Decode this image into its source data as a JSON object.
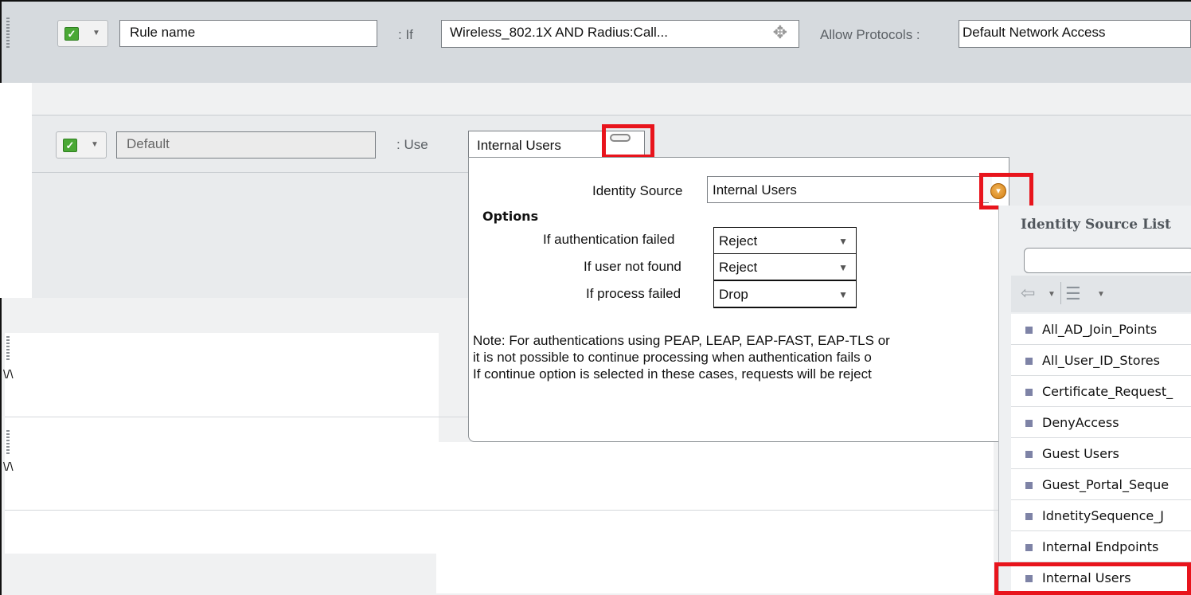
{
  "rule": {
    "name_value": "Rule name",
    "if_label": ": If",
    "condition": "Wireless_802.1X AND Radius:Call...",
    "allow_protocols_label": "Allow Protocols :",
    "allow_protocols_value": "Default Network Access"
  },
  "default_rule": {
    "name_value": "Default",
    "use_label": ":  Use",
    "identity_store": "Internal Users"
  },
  "popover": {
    "identity_source_label": "Identity Source",
    "identity_source_value": "Internal Users",
    "options_heading": "Options",
    "auth_failed_label": "If authentication failed",
    "auth_failed_value": "Reject",
    "user_not_found_label": "If user not found",
    "user_not_found_value": "Reject",
    "process_failed_label": "If process failed",
    "process_failed_value": "Drop",
    "note_line1": "Note: For authentications using PEAP, LEAP, EAP-FAST, EAP-TLS or",
    "note_line2": "it is not possible to continue processing when authentication fails o",
    "note_line3": "If continue option is selected in these cases, requests will be reject"
  },
  "identity_list": {
    "title": "Identity Source List",
    "search_placeholder": "",
    "items": [
      "All_AD_Join_Points",
      "All_User_ID_Stores",
      "Certificate_Request_",
      "DenyAccess",
      "Guest Users",
      "Guest_Portal_Seque",
      "IdnetitySequence_J",
      "Internal Endpoints",
      "Internal Users"
    ],
    "selected": "Internal Users"
  },
  "side_fragments": {
    "w1": "\\/\\",
    "w2": "\\/\\"
  },
  "colors": {
    "highlight": "#e8141c",
    "check": "#4aa835",
    "panel": "#d6dade"
  },
  "icons": [
    "checkbox-checked-icon",
    "chevron-down-icon",
    "expression-builder-icon",
    "minimize-icon",
    "dropdown-orange-icon",
    "back-arrow-icon",
    "list-view-icon",
    "list-bullet-icon"
  ]
}
